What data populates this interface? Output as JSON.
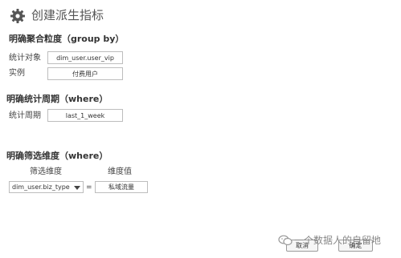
{
  "header": {
    "title": "创建派生指标",
    "icon": "gear-icon"
  },
  "grouping": {
    "heading": "明确聚合粒度（group by）",
    "stat_object_label": "统计对象",
    "stat_object_value": "dim_user.user_vip",
    "instance_label": "实例",
    "instance_value": "付费用户"
  },
  "period": {
    "heading": "明确统计周期（where）",
    "period_label": "统计周期",
    "period_value": "last_1_week"
  },
  "filter": {
    "heading": "明确筛选维度（where）",
    "dimension_col_label": "筛选维度",
    "value_col_label": "维度值",
    "dimension_value": "dim_user.biz_type",
    "operator": "=",
    "value": "私域流量"
  },
  "actions": {
    "cancel_label": "取消",
    "confirm_label": "确定"
  },
  "watermark": {
    "text": "一个数据人的自留地"
  },
  "colors": {
    "border": "#bdbdbd",
    "text": "#333333",
    "title": "#555555",
    "icon": "#555555"
  }
}
